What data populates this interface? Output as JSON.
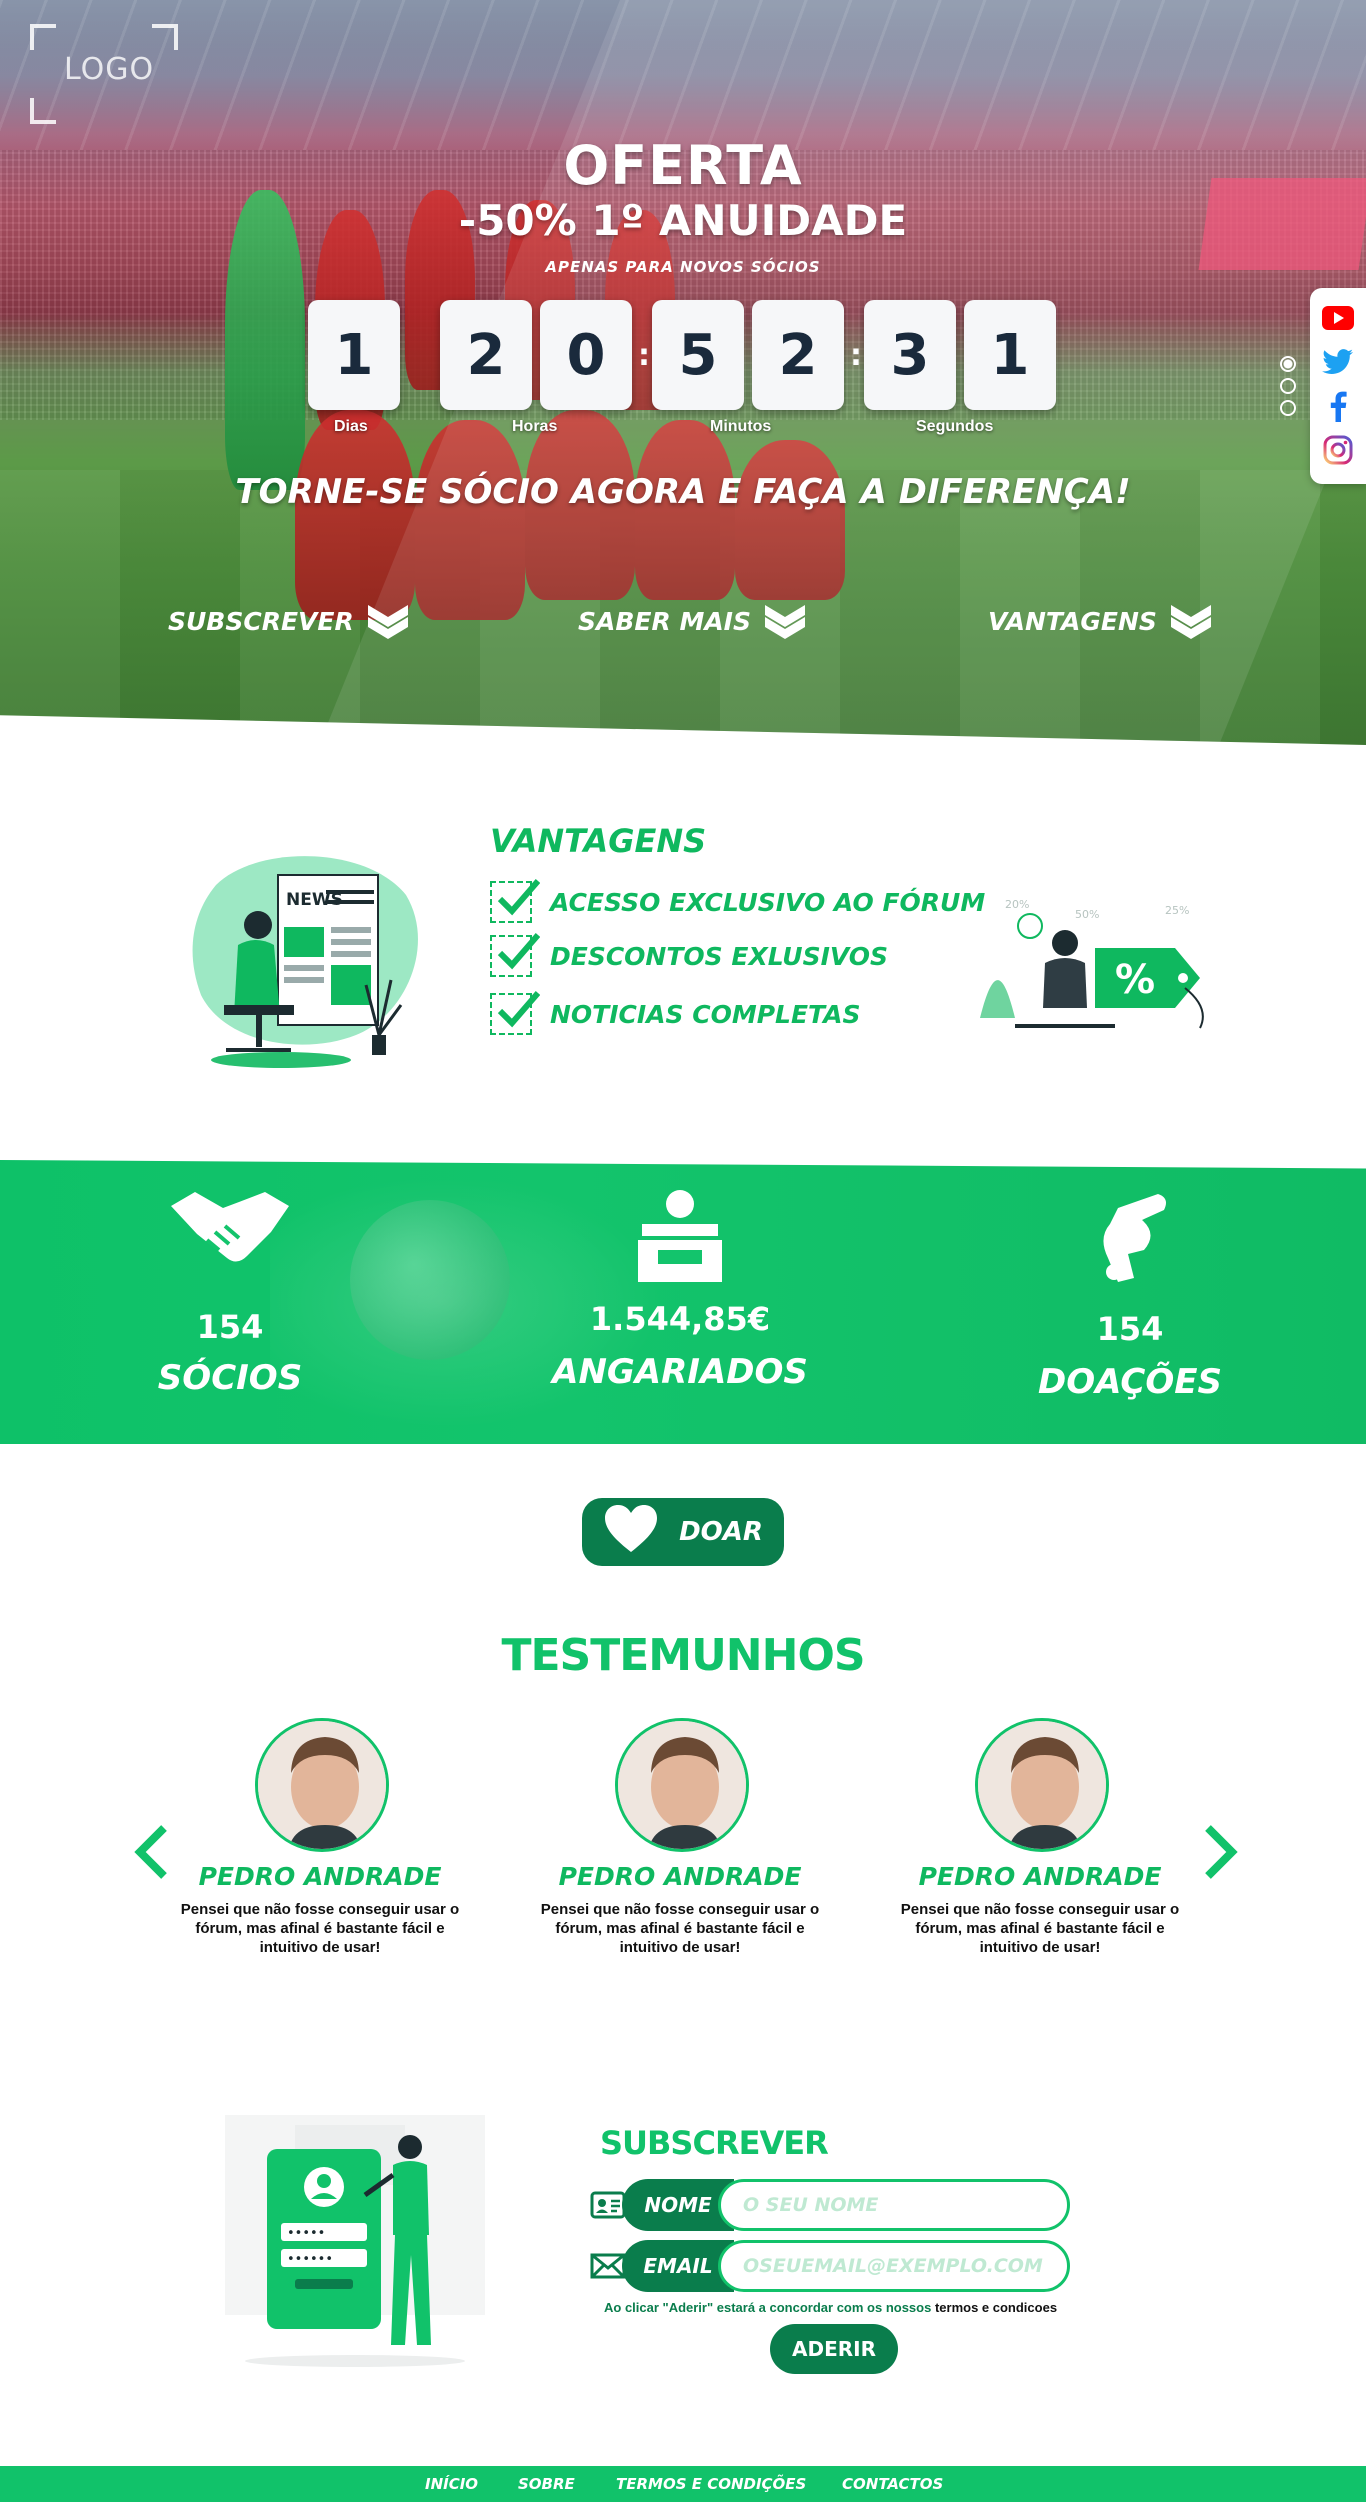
{
  "logo": {
    "text": "LOGO"
  },
  "hero": {
    "offer_title": "OFERTA",
    "offer_discount": "-50% 1º ANUIDADE",
    "offer_note": "APENAS PARA NOVOS SÓCIOS",
    "countdown": {
      "digits": [
        "1",
        "2",
        "0",
        "5",
        "2",
        "3",
        "1"
      ],
      "labels": {
        "days": "Dias",
        "hours": "Horas",
        "minutes": "Minutos",
        "seconds": "Segundos"
      }
    },
    "tagline": "TORNE-SE SÓCIO AGORA E FAÇA A DIFERENÇA!",
    "links": {
      "subscribe": "SUBSCREVER",
      "learn_more": "SABER MAIS",
      "benefits": "VANTAGENS"
    }
  },
  "social": {
    "icons": [
      "youtube-icon",
      "twitter-icon",
      "facebook-icon",
      "instagram-icon"
    ]
  },
  "vantagens": {
    "title": "VANTAGENS",
    "items": [
      "ACESSO EXCLUSIVO AO FÓRUM",
      "DESCONTOS EXLUSIVOS",
      "NOTICIAS COMPLETAS"
    ],
    "illustration_news_label": "NEWS",
    "discount_tags": [
      "20%",
      "50%",
      "25%"
    ],
    "discount_symbol": "%"
  },
  "stats": {
    "members": {
      "value": "154",
      "label": "SÓCIOS"
    },
    "raised": {
      "value": "1.544,85€",
      "label": "ANGARIADOS"
    },
    "donations": {
      "value": "154",
      "label": "DOAÇÕES"
    }
  },
  "donate": {
    "label": "DOAR"
  },
  "testimonials": {
    "title": "TESTEMUNHOS",
    "items": [
      {
        "name": "PEDRO ANDRADE",
        "text": "Pensei que não fosse conseguir usar o fórum, mas afinal é bastante fácil e intuitivo de usar!"
      },
      {
        "name": "PEDRO ANDRADE",
        "text": "Pensei que não fosse conseguir usar o fórum, mas afinal é bastante fácil e intuitivo de usar!"
      },
      {
        "name": "PEDRO ANDRADE",
        "text": "Pensei que não fosse conseguir usar o fórum, mas afinal é bastante fácil e intuitivo de usar!"
      }
    ]
  },
  "subscribe": {
    "title": "SUBSCREVER",
    "name_label": "NOME",
    "name_placeholder": "O SEU NOME",
    "email_label": "EMAIL",
    "email_placeholder": "OSEUEMAIL@EXEMPLO.COM",
    "terms_prefix": "Ao clicar \"Aderir\" estará a concordar com os nossos ",
    "terms_link": "termos e condicoes",
    "join_label": "ADERIR",
    "illustration_password": "•••••",
    "illustration_password2": "••••••"
  },
  "footer": {
    "links": [
      "INÍCIO",
      "SOBRE",
      "TERMOS E CONDIÇÕES",
      "CONTACTOS"
    ]
  },
  "colors": {
    "brand_green": "#11c26a",
    "dark_green": "#0a7d4c",
    "white": "#ffffff"
  }
}
